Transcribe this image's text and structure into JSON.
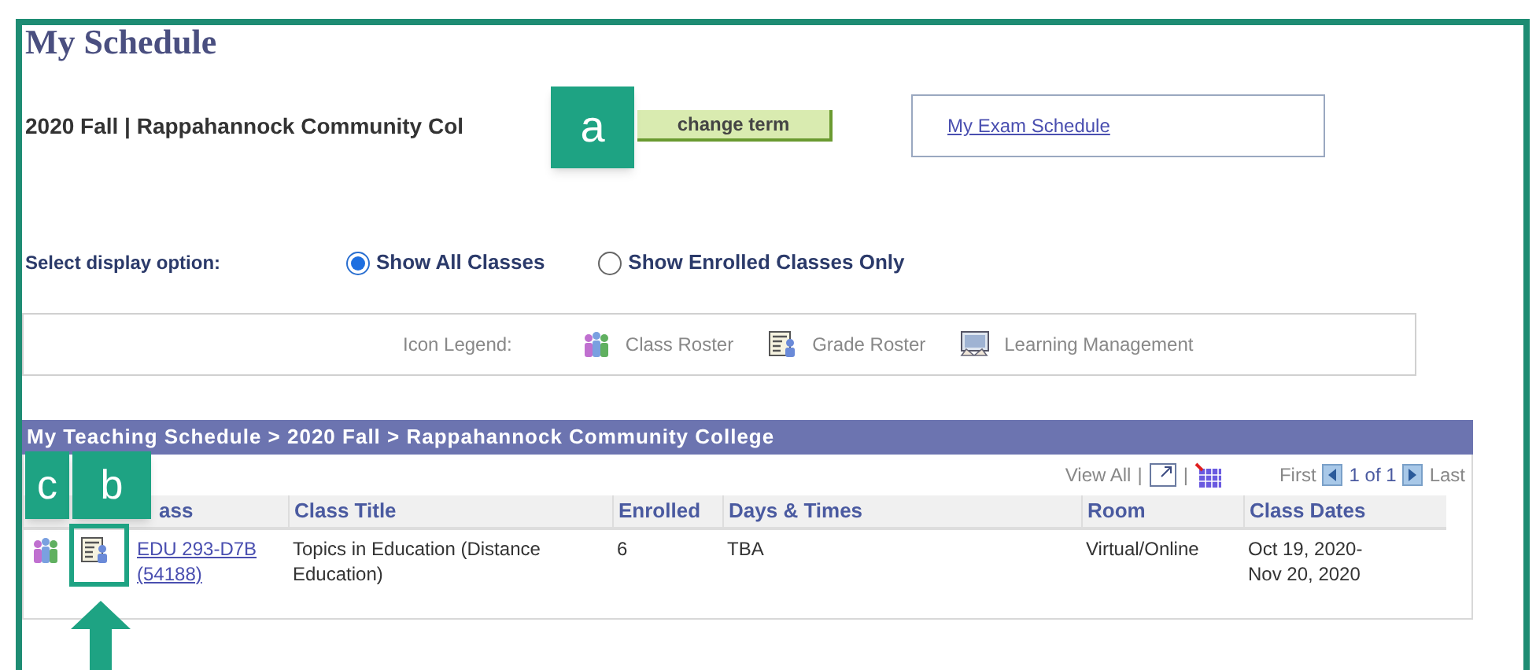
{
  "title": "My Schedule",
  "term": "2020 Fall | Rappahannock Community Col",
  "change_term_button": "change term",
  "exam_link": "My Exam Schedule",
  "display_option": {
    "label": "Select display option:",
    "options": [
      {
        "label": "Show All Classes",
        "selected": true
      },
      {
        "label": "Show Enrolled Classes Only",
        "selected": false
      }
    ]
  },
  "legend": {
    "label": "Icon Legend:",
    "items": [
      {
        "kind": "class_roster",
        "label": "Class Roster"
      },
      {
        "kind": "grade_roster",
        "label": "Grade Roster"
      },
      {
        "kind": "learning",
        "label": "Learning Management"
      }
    ]
  },
  "grid": {
    "title": "My Teaching Schedule > 2020 Fall > Rappahannock Community College",
    "view_all": "View All",
    "separators": [
      "|",
      "|"
    ],
    "first": "First",
    "page": "1 of 1",
    "last": "Last",
    "columns": [
      "ass",
      "Class Title",
      "Enrolled",
      "Days & Times",
      "Room",
      "Class Dates"
    ],
    "rows": [
      {
        "class": "EDU 293-D7B",
        "section": "(54188)",
        "title": "Topics in Education (Distance Education)",
        "enrolled": "6",
        "days": "TBA",
        "room": "Virtual/Online",
        "dates": "Oct 19, 2020-\nNov 20, 2020"
      }
    ]
  },
  "callouts": [
    {
      "kind": "a",
      "label": "a"
    },
    {
      "kind": "c",
      "label": "c"
    },
    {
      "kind": "b",
      "label": "b"
    }
  ]
}
